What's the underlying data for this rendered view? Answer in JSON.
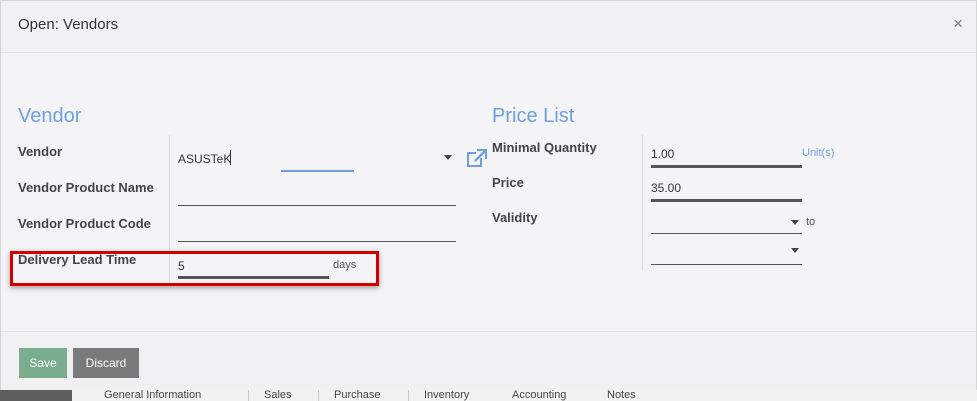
{
  "modal": {
    "title": "Open: Vendors",
    "close_label": "×"
  },
  "vendor_section": {
    "title": "Vendor",
    "vendor_label": "Vendor",
    "vendor_value": "ASUSTeK",
    "product_name_label": "Vendor Product Name",
    "product_code_label": "Vendor Product Code",
    "lead_time_label": "Delivery Lead Time",
    "lead_time_value": "5",
    "lead_time_unit": "days"
  },
  "price_section": {
    "title": "Price List",
    "min_qty_label": "Minimal Quantity",
    "min_qty_value": "1.00",
    "min_qty_unit": "Unit(s)",
    "price_label": "Price",
    "price_value": "35.00",
    "validity_label": "Validity",
    "validity_to": "to"
  },
  "footer": {
    "save_label": "Save",
    "discard_label": "Discard"
  },
  "background_tabs": [
    "General Information",
    "Sales",
    "Purchase",
    "Inventory",
    "Accounting",
    "Notes"
  ],
  "colors": {
    "accent": "#6ea0df",
    "save_button": "#7aad8d",
    "discard_button": "#7a7a7a",
    "highlight_box": "#d40000"
  }
}
